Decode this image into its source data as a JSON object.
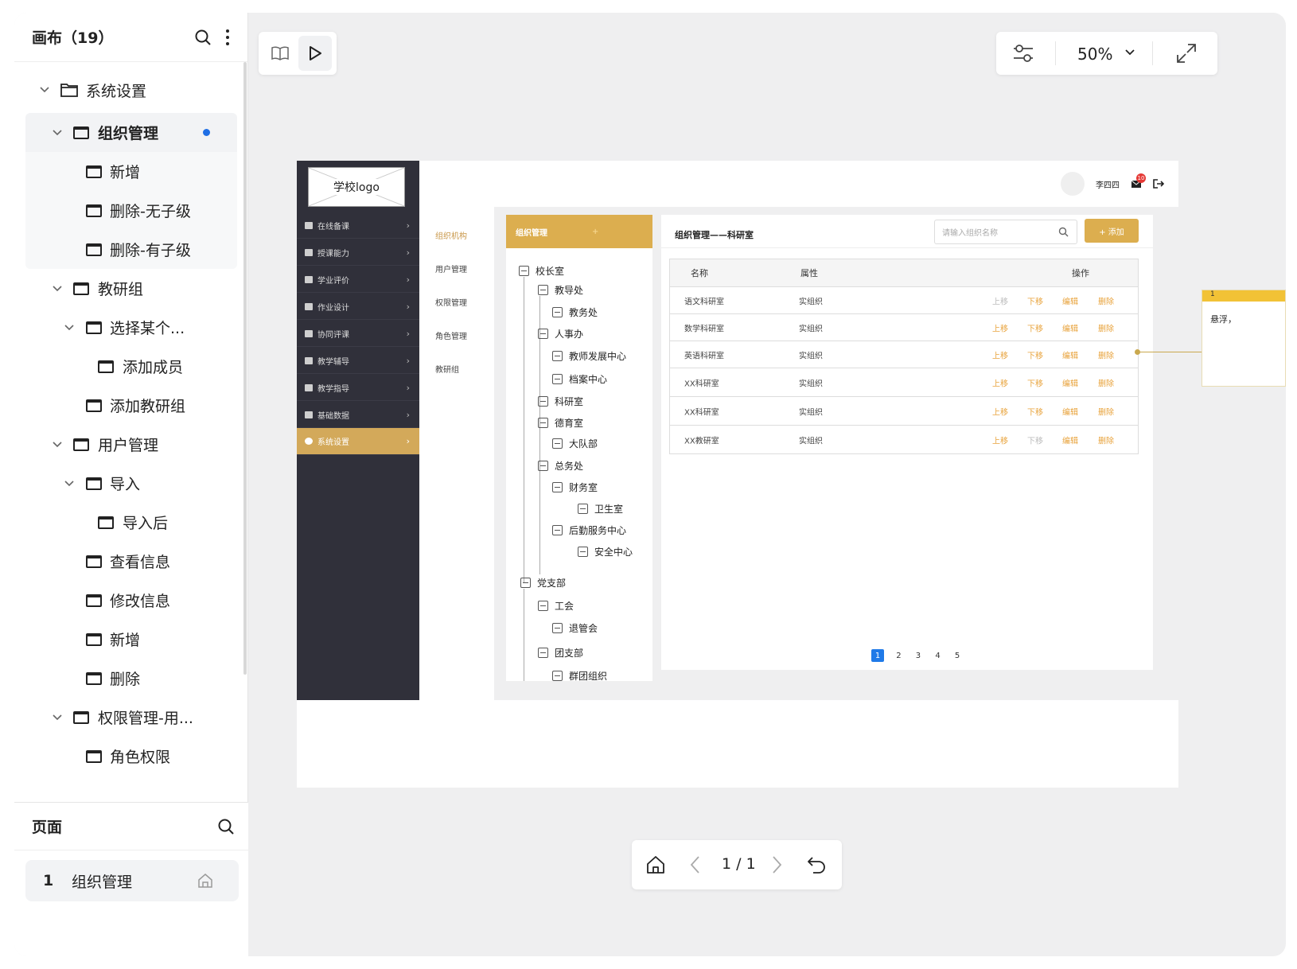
{
  "left_panel": {
    "title": "画布（19）",
    "tree": [
      {
        "label": "系统设置",
        "type": "folder"
      },
      {
        "label": "组织管理",
        "type": "page"
      },
      {
        "label": "新增",
        "type": "page"
      },
      {
        "label": "删除-无子级",
        "type": "page"
      },
      {
        "label": "删除-有子级",
        "type": "page"
      },
      {
        "label": "教研组",
        "type": "page"
      },
      {
        "label": "选择某个...",
        "type": "page"
      },
      {
        "label": "添加成员",
        "type": "page"
      },
      {
        "label": "添加教研组",
        "type": "page"
      },
      {
        "label": "用户管理",
        "type": "page"
      },
      {
        "label": "导入",
        "type": "page"
      },
      {
        "label": "导入后",
        "type": "page"
      },
      {
        "label": "查看信息",
        "type": "page"
      },
      {
        "label": "修改信息",
        "type": "page"
      },
      {
        "label": "新增",
        "type": "page"
      },
      {
        "label": "删除",
        "type": "page"
      },
      {
        "label": "权限管理-用...",
        "type": "page"
      },
      {
        "label": "角色权限",
        "type": "page"
      }
    ],
    "pages_title": "页面",
    "pages": [
      {
        "num": "1",
        "label": "组织管理"
      }
    ]
  },
  "toolbar": {
    "zoom": "50%",
    "page_indicator": "1 / 1"
  },
  "mock": {
    "logo": "学校logo",
    "user": "李四四",
    "badge": "10",
    "menu": [
      "在线备课",
      "授课能力",
      "学业评价",
      "作业设计",
      "协同评课",
      "教学辅导",
      "教学指导",
      "基础数据",
      "系统设置"
    ],
    "subnav": [
      "组织机构",
      "用户管理",
      "权限管理",
      "角色管理",
      "教研组"
    ],
    "tree_title": "组织管理",
    "tree_plus": "+",
    "org_tree": [
      "校长室",
      "教导处",
      "教务处",
      "人事办",
      "教师发展中心",
      "档案中心",
      "科研室",
      "德育室",
      "大队部",
      "总务处",
      "财务室",
      "卫生室",
      "后勤服务中心",
      "安全中心",
      "党支部",
      "工会",
      "退管会",
      "团支部",
      "群团组织"
    ],
    "crumb": "组织管理——科研室",
    "search_placeholder": "请输入组织名称",
    "add_label": "+ 添加",
    "table_headers": [
      "名称",
      "属性",
      "操作"
    ],
    "rows": [
      {
        "name": "语文科研室",
        "attr": "实组织"
      },
      {
        "name": "数学科研室",
        "attr": "实组织"
      },
      {
        "name": "英语科研室",
        "attr": "实组织"
      },
      {
        "name": "XX科研室",
        "attr": "实组织"
      },
      {
        "name": "XX科研室",
        "attr": "实组织"
      },
      {
        "name": "XX教研室",
        "attr": "实组织"
      }
    ],
    "ops": [
      "上移",
      "下移",
      "编辑",
      "删除"
    ],
    "pages": [
      "1",
      "2",
      "3",
      "4",
      "5"
    ]
  },
  "note": {
    "num": "1",
    "text": "悬浮，"
  }
}
